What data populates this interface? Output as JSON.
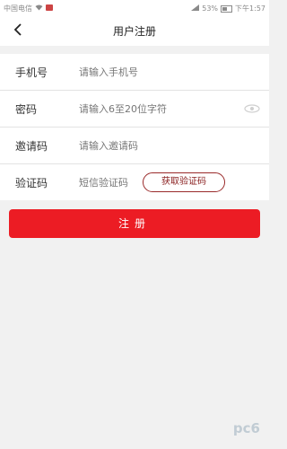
{
  "status_bar": {
    "carrier": "中国电信",
    "battery": "53%",
    "time": "下午1:57",
    "icons": [
      "wifi-icon",
      "signal-icon",
      "battery-icon"
    ]
  },
  "header": {
    "title": "用户注册",
    "back_icon": "chevron-left-icon"
  },
  "form": {
    "phone": {
      "label": "手机号",
      "placeholder": "请输入手机号"
    },
    "password": {
      "label": "密码",
      "placeholder": "请输入6至20位字符",
      "icon": "eye-icon"
    },
    "invite": {
      "label": "邀请码",
      "placeholder": "请输入邀请码"
    },
    "verify": {
      "label": "验证码",
      "placeholder": "短信验证码",
      "button_label": "获取验证码"
    }
  },
  "register_button": {
    "label": "注册"
  },
  "watermark": {
    "text": "pc6"
  },
  "colors": {
    "accent": "#ec1c24",
    "code_button_border": "#9a2a2a",
    "background": "#f1f1f1"
  }
}
